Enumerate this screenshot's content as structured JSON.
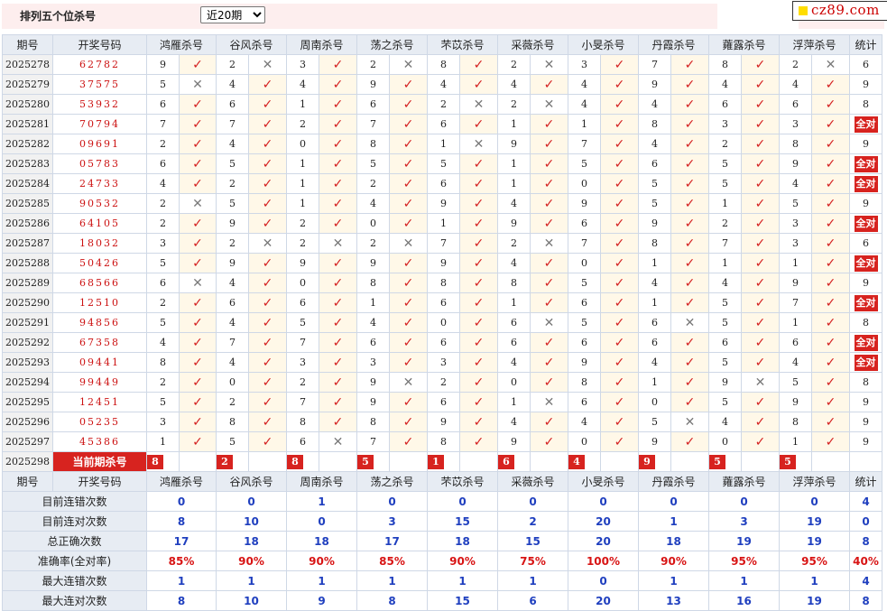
{
  "toolbar": {
    "title": "排列五个位杀号",
    "range_selected": "近20期",
    "logo_text": "cz89.com"
  },
  "colors": {
    "accent_red": "#d7231f",
    "check_red": "#d42020",
    "stat_blue": "#1f3fbf"
  },
  "icons": {
    "check": "check-mark-icon",
    "cross": "cross-mark-icon"
  },
  "header": {
    "period": "期号",
    "winning": "开奖号码",
    "experts": [
      "鸿雁杀号",
      "谷风杀号",
      "周南杀号",
      "荡之杀号",
      "芣苡杀号",
      "采薇杀号",
      "小旻杀号",
      "丹霞杀号",
      "蕹露杀号",
      "浮萍杀号"
    ],
    "stat": "统计"
  },
  "rows": [
    {
      "p": "2025278",
      "w": "62782",
      "v": [
        "9",
        "2",
        "3",
        "2",
        "8",
        "2",
        "3",
        "7",
        "8",
        "2"
      ],
      "ok": [
        1,
        0,
        1,
        0,
        1,
        0,
        1,
        1,
        1,
        0
      ],
      "s": "6"
    },
    {
      "p": "2025279",
      "w": "37575",
      "v": [
        "5",
        "4",
        "4",
        "9",
        "4",
        "4",
        "4",
        "9",
        "4",
        "4"
      ],
      "ok": [
        0,
        1,
        1,
        1,
        1,
        1,
        1,
        1,
        1,
        1
      ],
      "s": "9"
    },
    {
      "p": "2025280",
      "w": "53932",
      "v": [
        "6",
        "6",
        "1",
        "6",
        "2",
        "2",
        "4",
        "4",
        "6",
        "6"
      ],
      "ok": [
        1,
        1,
        1,
        1,
        0,
        0,
        1,
        1,
        1,
        1
      ],
      "s": "8"
    },
    {
      "p": "2025281",
      "w": "70794",
      "v": [
        "7",
        "7",
        "2",
        "7",
        "6",
        "1",
        "1",
        "8",
        "3",
        "3"
      ],
      "ok": [
        1,
        1,
        1,
        1,
        1,
        1,
        1,
        1,
        1,
        1
      ],
      "s": "全对"
    },
    {
      "p": "2025282",
      "w": "09691",
      "v": [
        "2",
        "4",
        "0",
        "8",
        "1",
        "9",
        "7",
        "4",
        "2",
        "8"
      ],
      "ok": [
        1,
        1,
        1,
        1,
        0,
        1,
        1,
        1,
        1,
        1
      ],
      "s": "9"
    },
    {
      "p": "2025283",
      "w": "05783",
      "v": [
        "6",
        "5",
        "1",
        "5",
        "5",
        "1",
        "5",
        "6",
        "5",
        "9"
      ],
      "ok": [
        1,
        1,
        1,
        1,
        1,
        1,
        1,
        1,
        1,
        1
      ],
      "s": "全对"
    },
    {
      "p": "2025284",
      "w": "24733",
      "v": [
        "4",
        "2",
        "1",
        "2",
        "6",
        "1",
        "0",
        "5",
        "5",
        "4"
      ],
      "ok": [
        1,
        1,
        1,
        1,
        1,
        1,
        1,
        1,
        1,
        1
      ],
      "s": "全对"
    },
    {
      "p": "2025285",
      "w": "90532",
      "v": [
        "2",
        "5",
        "1",
        "4",
        "9",
        "4",
        "9",
        "5",
        "1",
        "5"
      ],
      "ok": [
        0,
        1,
        1,
        1,
        1,
        1,
        1,
        1,
        1,
        1
      ],
      "s": "9"
    },
    {
      "p": "2025286",
      "w": "64105",
      "v": [
        "2",
        "9",
        "2",
        "0",
        "1",
        "9",
        "6",
        "9",
        "2",
        "3"
      ],
      "ok": [
        1,
        1,
        1,
        1,
        1,
        1,
        1,
        1,
        1,
        1
      ],
      "s": "全对"
    },
    {
      "p": "2025287",
      "w": "18032",
      "v": [
        "3",
        "2",
        "2",
        "2",
        "7",
        "2",
        "7",
        "8",
        "7",
        "3"
      ],
      "ok": [
        1,
        0,
        0,
        0,
        1,
        0,
        1,
        1,
        1,
        1
      ],
      "s": "6"
    },
    {
      "p": "2025288",
      "w": "50426",
      "v": [
        "5",
        "9",
        "9",
        "9",
        "9",
        "4",
        "0",
        "1",
        "1",
        "1"
      ],
      "ok": [
        1,
        1,
        1,
        1,
        1,
        1,
        1,
        1,
        1,
        1
      ],
      "s": "全对"
    },
    {
      "p": "2025289",
      "w": "68566",
      "v": [
        "6",
        "4",
        "0",
        "8",
        "8",
        "8",
        "5",
        "4",
        "4",
        "9"
      ],
      "ok": [
        0,
        1,
        1,
        1,
        1,
        1,
        1,
        1,
        1,
        1
      ],
      "s": "9"
    },
    {
      "p": "2025290",
      "w": "12510",
      "v": [
        "2",
        "6",
        "6",
        "1",
        "6",
        "1",
        "6",
        "1",
        "5",
        "7"
      ],
      "ok": [
        1,
        1,
        1,
        1,
        1,
        1,
        1,
        1,
        1,
        1
      ],
      "s": "全对"
    },
    {
      "p": "2025291",
      "w": "94856",
      "v": [
        "5",
        "4",
        "5",
        "4",
        "0",
        "6",
        "5",
        "6",
        "5",
        "1"
      ],
      "ok": [
        1,
        1,
        1,
        1,
        1,
        0,
        1,
        0,
        1,
        1
      ],
      "s": "8"
    },
    {
      "p": "2025292",
      "w": "67358",
      "v": [
        "4",
        "7",
        "7",
        "6",
        "6",
        "6",
        "6",
        "6",
        "6",
        "6"
      ],
      "ok": [
        1,
        1,
        1,
        1,
        1,
        1,
        1,
        1,
        1,
        1
      ],
      "s": "全对"
    },
    {
      "p": "2025293",
      "w": "09441",
      "v": [
        "8",
        "4",
        "3",
        "3",
        "3",
        "4",
        "9",
        "4",
        "5",
        "4"
      ],
      "ok": [
        1,
        1,
        1,
        1,
        1,
        1,
        1,
        1,
        1,
        1
      ],
      "s": "全对"
    },
    {
      "p": "2025294",
      "w": "99449",
      "v": [
        "2",
        "0",
        "2",
        "9",
        "2",
        "0",
        "8",
        "1",
        "9",
        "5"
      ],
      "ok": [
        1,
        1,
        1,
        0,
        1,
        1,
        1,
        1,
        0,
        1
      ],
      "s": "8"
    },
    {
      "p": "2025295",
      "w": "12451",
      "v": [
        "5",
        "2",
        "7",
        "9",
        "6",
        "1",
        "6",
        "0",
        "5",
        "9"
      ],
      "ok": [
        1,
        1,
        1,
        1,
        1,
        0,
        1,
        1,
        1,
        1
      ],
      "s": "9"
    },
    {
      "p": "2025296",
      "w": "05235",
      "v": [
        "3",
        "8",
        "8",
        "8",
        "9",
        "4",
        "4",
        "5",
        "4",
        "8"
      ],
      "ok": [
        1,
        1,
        1,
        1,
        1,
        1,
        1,
        0,
        1,
        1
      ],
      "s": "9"
    },
    {
      "p": "2025297",
      "w": "45386",
      "v": [
        "1",
        "5",
        "6",
        "7",
        "8",
        "9",
        "0",
        "9",
        "0",
        "1"
      ],
      "ok": [
        1,
        1,
        0,
        1,
        1,
        1,
        1,
        1,
        1,
        1
      ],
      "s": "9"
    }
  ],
  "current": {
    "period": "2025298",
    "label": "当前期杀号",
    "values": [
      "8",
      "2",
      "8",
      "5",
      "1",
      "6",
      "4",
      "9",
      "5",
      "5"
    ]
  },
  "stats": [
    {
      "label": "目前连错次数",
      "values": [
        "0",
        "0",
        "1",
        "0",
        "0",
        "0",
        "0",
        "0",
        "0",
        "0",
        "4"
      ],
      "red": false
    },
    {
      "label": "目前连对次数",
      "values": [
        "8",
        "10",
        "0",
        "3",
        "15",
        "2",
        "20",
        "1",
        "3",
        "19",
        "0"
      ],
      "red": false
    },
    {
      "label": "总正确次数",
      "values": [
        "17",
        "18",
        "18",
        "17",
        "18",
        "15",
        "20",
        "18",
        "19",
        "19",
        "8"
      ],
      "red": false
    },
    {
      "label": "准确率(全对率)",
      "values": [
        "85%",
        "90%",
        "90%",
        "85%",
        "90%",
        "75%",
        "100%",
        "90%",
        "95%",
        "95%",
        "40%"
      ],
      "red": true
    },
    {
      "label": "最大连错次数",
      "values": [
        "1",
        "1",
        "1",
        "1",
        "1",
        "1",
        "0",
        "1",
        "1",
        "1",
        "4"
      ],
      "red": false
    },
    {
      "label": "最大连对次数",
      "values": [
        "8",
        "10",
        "9",
        "8",
        "15",
        "6",
        "20",
        "13",
        "16",
        "19",
        "8"
      ],
      "red": false
    }
  ]
}
